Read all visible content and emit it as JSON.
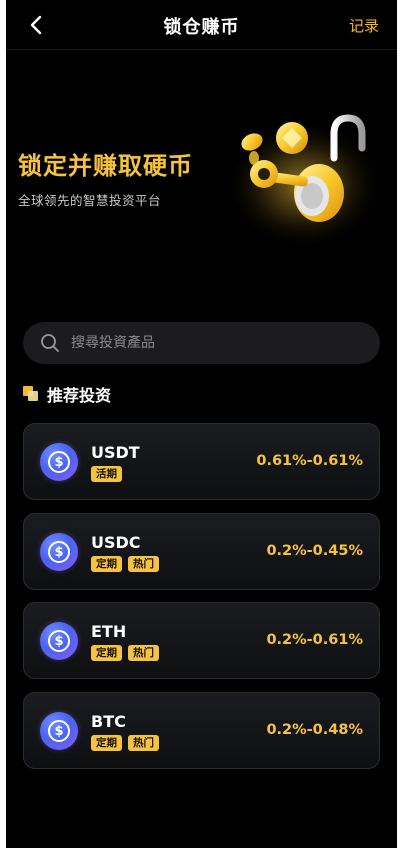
{
  "header": {
    "title": "锁仓赚币",
    "record_label": "记录"
  },
  "hero": {
    "title": "锁定并赚取硬币",
    "subtitle": "全球领先的智慧投资平台"
  },
  "search": {
    "placeholder": "搜尋投資產品"
  },
  "section": {
    "title": "推荐投资"
  },
  "products": [
    {
      "name": "USDT",
      "tags": [
        "活期"
      ],
      "rate": "0.61%-0.61%"
    },
    {
      "name": "USDC",
      "tags": [
        "定期",
        "热门"
      ],
      "rate": "0.2%-0.45%"
    },
    {
      "name": "ETH",
      "tags": [
        "定期",
        "热门"
      ],
      "rate": "0.2%-0.61%"
    },
    {
      "name": "BTC",
      "tags": [
        "定期",
        "热门"
      ],
      "rate": "0.2%-0.48%"
    }
  ],
  "icons": {
    "back": "chevron-left-icon",
    "search": "search-icon",
    "coin": "dollar-coin-icon",
    "hero": "lock-key-coins-illustration"
  },
  "colors": {
    "accent": "#f5c341",
    "background": "#000000",
    "card": "#16171a",
    "coin": "#5b6cf5"
  }
}
